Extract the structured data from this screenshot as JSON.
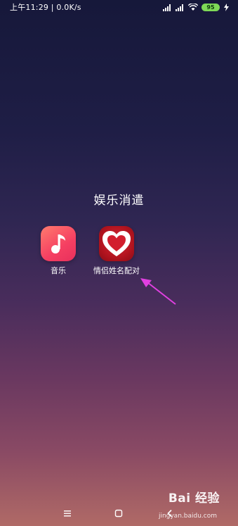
{
  "status_bar": {
    "time_speed": "上午11:29 | 0.0K/s",
    "battery": "95"
  },
  "folder": {
    "title": "娱乐消遣",
    "apps": [
      {
        "label": "音乐",
        "icon": "music-note-icon"
      },
      {
        "label": "情侣姓名配对",
        "icon": "heart-icon"
      }
    ]
  },
  "annotation": {
    "color": "#e040e0",
    "icon": "pointer-arrow"
  },
  "nav": {
    "menu_icon": "menu-icon",
    "home_icon": "home-icon",
    "back_icon": "back-icon"
  },
  "watermark": {
    "brand": "Bai 经验",
    "url": "jingyan.baidu.com"
  }
}
